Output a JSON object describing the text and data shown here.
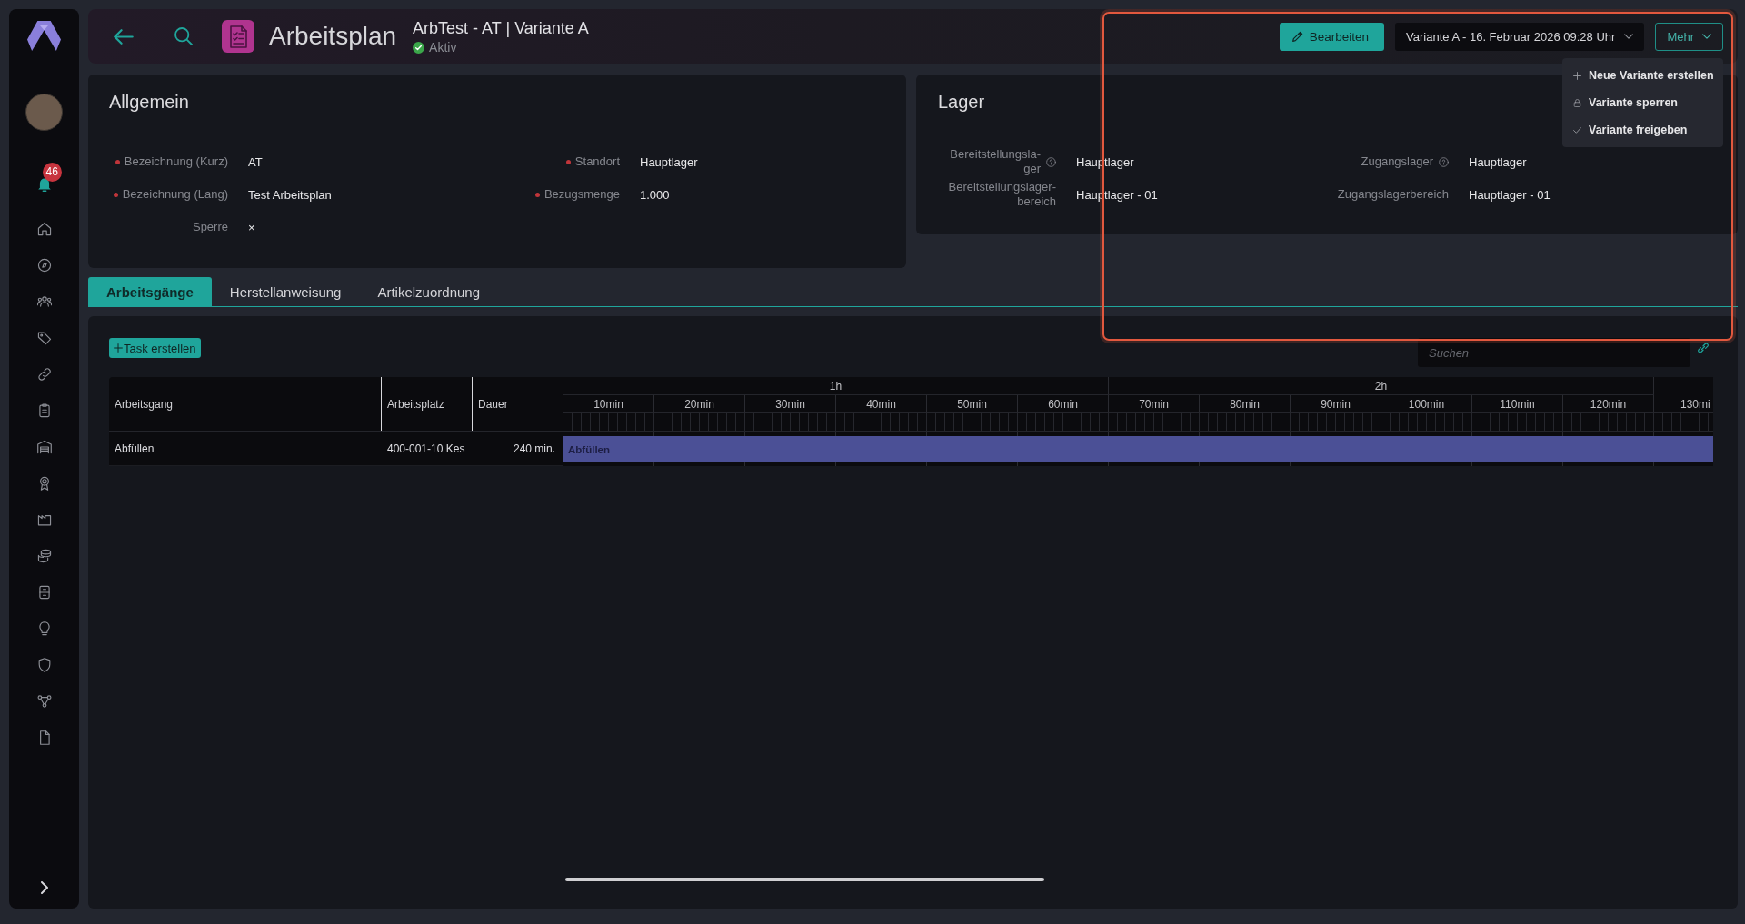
{
  "sidebar": {
    "notification_count": "46"
  },
  "header": {
    "title": "Arbeitsplan",
    "record": "ArbTest - AT | Variante A",
    "status": {
      "kind": "active",
      "label": "Aktiv"
    },
    "edit_button": "Bearbeiten",
    "variant_select": "Variante A - 16. Februar 2026 09:28 Uhr",
    "more_button": {
      "label": "Mehr",
      "expanded": true
    },
    "more_menu": [
      {
        "kind": "add",
        "label": "Neue Variante erstellen"
      },
      {
        "kind": "lock",
        "label": "Variante sperren"
      },
      {
        "kind": "check",
        "label": "Variante freigeben"
      }
    ]
  },
  "general": {
    "title": "Allgemein",
    "columns": [
      [
        {
          "label": "Bezeichnung (Kurz)",
          "required": true,
          "value": "AT"
        },
        {
          "label": "Bezeichnung (Lang)",
          "required": true,
          "value": "Test Arbeitsplan"
        },
        {
          "label": "Sperre",
          "required": false,
          "value": "×"
        }
      ],
      [
        {
          "label": "Standort",
          "required": true,
          "value": "Hauptlager"
        },
        {
          "label": "Bezugsmenge",
          "required": true,
          "value": "1.000"
        }
      ]
    ]
  },
  "storage": {
    "title": "Lager",
    "columns": [
      [
        {
          "label": "Bereitstellungsla-ger",
          "help": true,
          "value": "Hauptlager"
        },
        {
          "label": "Bereitstellungslager-bereich",
          "help": false,
          "value": "Hauptlager - 01"
        }
      ],
      [
        {
          "label": "Zugangslager",
          "help": true,
          "value": "Hauptlager"
        },
        {
          "label": "Zugangslagerbereich",
          "help": false,
          "value": "Hauptlager - 01"
        }
      ]
    ]
  },
  "tabs": [
    {
      "label": "Arbeitsgänge",
      "selected": true
    },
    {
      "label": "Herstellanweisung",
      "selected": false
    },
    {
      "label": "Artikelzuordnung",
      "selected": false
    }
  ],
  "operations": {
    "create_button": "Task erstellen",
    "search": {
      "placeholder": "Suchen"
    },
    "gantt": {
      "columns": [
        "Arbeitsgang",
        "Arbeitsplatz",
        "Dauer"
      ],
      "hours": [
        "1h",
        "2h"
      ],
      "minutes": [
        "10min",
        "20min",
        "30min",
        "40min",
        "50min",
        "60min",
        "70min",
        "80min",
        "90min",
        "100min",
        "110min",
        "120min",
        "130mi"
      ],
      "rows": [
        {
          "operation": "Abfüllen",
          "workplace": "400-001-10 Kes",
          "duration": "240 min.",
          "bar_label": "Abfüllen"
        }
      ]
    }
  }
}
